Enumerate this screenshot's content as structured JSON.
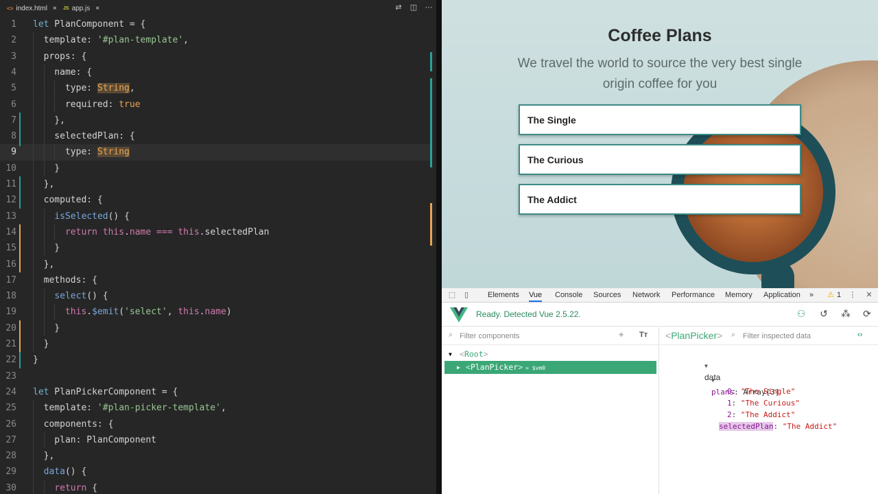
{
  "editor": {
    "tabs": [
      {
        "icon": "<>",
        "label": "index.html",
        "close": "×"
      },
      {
        "icon": "JS",
        "label": "app.js",
        "close": "×"
      }
    ],
    "lines": [
      {
        "n": "1",
        "html": "<span class='kb'>let</span> PlanComponent = {"
      },
      {
        "n": "2",
        "html": "  template: <span class='s'>'#plan-template'</span>,"
      },
      {
        "n": "3",
        "html": "  props: {"
      },
      {
        "n": "4",
        "html": "    name: {"
      },
      {
        "n": "5",
        "html": "      type: <span class='hl'>String</span>,"
      },
      {
        "n": "6",
        "html": "      required: <span class='t'>true</span>"
      },
      {
        "n": "7",
        "html": "    },"
      },
      {
        "n": "8",
        "html": "    selectedPlan: {"
      },
      {
        "n": "9",
        "html": "      type: <span class='hl'>String</span>"
      },
      {
        "n": "10",
        "html": "    }"
      },
      {
        "n": "11",
        "html": "  },"
      },
      {
        "n": "12",
        "html": "  computed: {"
      },
      {
        "n": "13",
        "html": "    <span class='f'>isSelected</span>() {"
      },
      {
        "n": "14",
        "html": "      <span class='k'>return</span> <span class='k'>this</span>.<span class='k'>name</span> <span class='k'>===</span> <span class='k'>this</span>.selectedPlan"
      },
      {
        "n": "15",
        "html": "    }"
      },
      {
        "n": "16",
        "html": "  },"
      },
      {
        "n": "17",
        "html": "  methods: {"
      },
      {
        "n": "18",
        "html": "    <span class='f'>select</span>() {"
      },
      {
        "n": "19",
        "html": "      <span class='k'>this</span>.<span class='f'>$emit</span>(<span class='s'>'select'</span>, <span class='k'>this</span>.<span class='k'>name</span>)"
      },
      {
        "n": "20",
        "html": "    }"
      },
      {
        "n": "21",
        "html": "  }"
      },
      {
        "n": "22",
        "html": "}"
      },
      {
        "n": "23",
        "html": ""
      },
      {
        "n": "24",
        "html": "<span class='kb'>let</span> PlanPickerComponent = {"
      },
      {
        "n": "25",
        "html": "  template: <span class='s'>'#plan-picker-template'</span>,"
      },
      {
        "n": "26",
        "html": "  components: {"
      },
      {
        "n": "27",
        "html": "    plan: PlanComponent"
      },
      {
        "n": "28",
        "html": "  },"
      },
      {
        "n": "29",
        "html": "  <span class='f'>data</span>() {"
      },
      {
        "n": "30",
        "html": "    <span class='k'>return</span> {"
      }
    ],
    "current_line": 9
  },
  "page": {
    "title": "Coffee Plans",
    "subtitle": "We travel the world to source the very best single origin coffee for you",
    "plans": [
      "The Single",
      "The Curious",
      "The Addict"
    ]
  },
  "devtools": {
    "tabs": [
      "Elements",
      "Vue",
      "Console",
      "Sources",
      "Network",
      "Performance",
      "Memory",
      "Application"
    ],
    "active_tab": "Vue",
    "more": "»",
    "warnings": "1",
    "vue_status": "Ready. Detected Vue 2.5.22.",
    "filter_components_placeholder": "Filter components",
    "filter_data_placeholder": "Filter inspected data",
    "tree": {
      "root": "Root",
      "child": "PlanPicker",
      "child_suffix": "= $vm0"
    },
    "inspected": "PlanPicker",
    "data": {
      "section": "data",
      "plans_key": "plans",
      "plans_type": "Array[3]",
      "items": [
        {
          "index": "0",
          "value": "\"The Single\""
        },
        {
          "index": "1",
          "value": "\"The Curious\""
        },
        {
          "index": "2",
          "value": "\"The Addict\""
        }
      ],
      "selected_key": "selectedPlan",
      "selected_value": "\"The Addict\""
    }
  },
  "colors": {
    "vue_green": "#3ba776",
    "editor_bg": "#262626",
    "plan_border": "#3b8a86"
  }
}
